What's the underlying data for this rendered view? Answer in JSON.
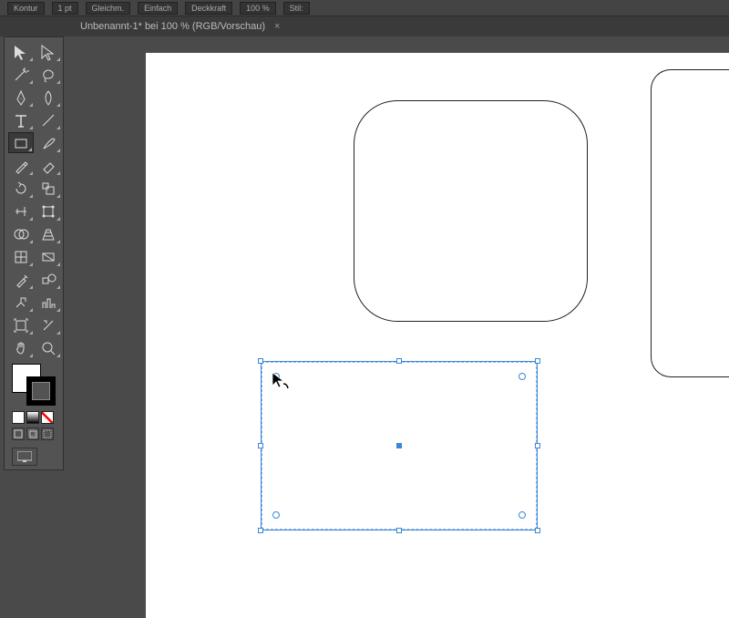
{
  "options_bar": {
    "stroke_label": "Kontur",
    "stroke_weight": "1 pt",
    "uniform": "Gleichm.",
    "profile": "Einfach",
    "opacity_label": "Deckkraft",
    "opacity_value": "100 %",
    "style_label": "Stil:"
  },
  "document_tab": {
    "title": "Unbenannt-1* bei 100 % (RGB/Vorschau)",
    "close": "×"
  },
  "tools": [
    {
      "name": "selection-tool",
      "interact": true
    },
    {
      "name": "direct-selection-tool",
      "interact": true
    },
    {
      "name": "magic-wand-tool",
      "interact": true
    },
    {
      "name": "lasso-tool",
      "interact": true
    },
    {
      "name": "pen-tool",
      "interact": true
    },
    {
      "name": "curvature-tool",
      "interact": true
    },
    {
      "name": "type-tool",
      "interact": true
    },
    {
      "name": "line-segment-tool",
      "interact": true
    },
    {
      "name": "rectangle-tool",
      "interact": true,
      "active": true
    },
    {
      "name": "paintbrush-tool",
      "interact": true
    },
    {
      "name": "pencil-tool",
      "interact": true
    },
    {
      "name": "eraser-tool",
      "interact": true
    },
    {
      "name": "rotate-tool",
      "interact": true
    },
    {
      "name": "scale-tool",
      "interact": true
    },
    {
      "name": "width-tool",
      "interact": true
    },
    {
      "name": "free-transform-tool",
      "interact": true
    },
    {
      "name": "shape-builder-tool",
      "interact": true
    },
    {
      "name": "perspective-tool",
      "interact": true
    },
    {
      "name": "mesh-tool",
      "interact": true
    },
    {
      "name": "gradient-tool",
      "interact": true
    },
    {
      "name": "eyedropper-tool",
      "interact": true
    },
    {
      "name": "blend-tool",
      "interact": true
    },
    {
      "name": "symbol-sprayer-tool",
      "interact": true
    },
    {
      "name": "column-graph-tool",
      "interact": true
    },
    {
      "name": "artboard-tool",
      "interact": true
    },
    {
      "name": "slice-tool",
      "interact": true
    },
    {
      "name": "hand-tool",
      "interact": true
    },
    {
      "name": "zoom-tool",
      "interact": true
    }
  ],
  "swatches": {
    "fill": "#ffffff",
    "stroke": "#000000"
  }
}
